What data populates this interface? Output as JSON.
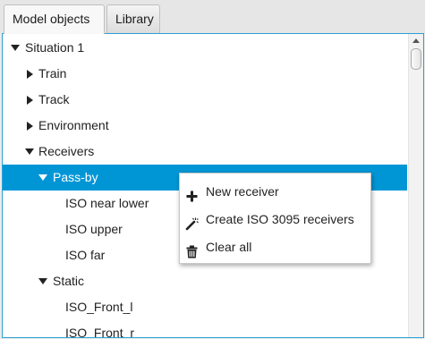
{
  "tabs": [
    {
      "label": "Model objects",
      "active": true
    },
    {
      "label": "Library",
      "active": false
    }
  ],
  "tree": {
    "situation": "Situation 1",
    "train": "Train",
    "track": "Track",
    "environment": "Environment",
    "receivers": "Receivers",
    "pass_by": "Pass-by",
    "iso_near_lower": "ISO near lower",
    "iso_upper": "ISO upper",
    "iso_far": "ISO far",
    "static": "Static",
    "iso_front_l": "ISO_Front_l",
    "iso_front_r": "ISO_Front_r"
  },
  "context_menu": {
    "new_receiver": "New receiver",
    "create_iso": "Create ISO 3095 receivers",
    "clear_all": "Clear all"
  },
  "icons": {
    "expanded": "triangle-down",
    "collapsed": "triangle-right",
    "new_receiver": "plus-icon",
    "create_iso": "magic-wand-icon",
    "clear_all": "trash-icon"
  },
  "colors": {
    "selection": "#0096d6",
    "panel_border": "#2c9fd6"
  }
}
